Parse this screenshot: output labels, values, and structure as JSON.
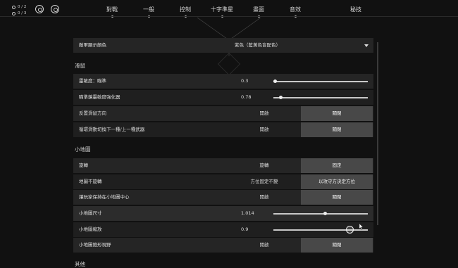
{
  "hud": {
    "counter_a": "0 / 2",
    "counter_b": "0 / 3"
  },
  "tabs": [
    {
      "label": "對戰"
    },
    {
      "label": "一般"
    },
    {
      "label": "控制"
    },
    {
      "label": "十字準星"
    },
    {
      "label": "畫面"
    },
    {
      "label": "音效"
    },
    {
      "label": "秘技"
    }
  ],
  "settings": {
    "highlight_color": {
      "label": "敵軍顯示顏色",
      "value": "紫色（藍黃色盲配色）"
    },
    "mouse_section": "滑鼠",
    "sensitivity": {
      "label": "靈敏度：瞄準",
      "value": "0.3",
      "level": 0.02
    },
    "scope_multiplier": {
      "label": "瞄準鏡靈敏度強化器",
      "value": "0.78",
      "level": 0.08
    },
    "invert_mouse": {
      "label": "反置滑鼠方向",
      "on": "開啟",
      "off": "關閉"
    },
    "scroll_weapon": {
      "label": "循環滑動切換下一種/上一種武器",
      "on": "開啟",
      "off": "關閉"
    },
    "minimap_section": "小地圖",
    "rotate": {
      "label": "旋轉",
      "on": "旋轉",
      "off": "固定"
    },
    "fixed_orientation": {
      "label": "地圖不旋轉",
      "on": "方位固定不變",
      "off": "以攻守方決定方位"
    },
    "keep_centered": {
      "label": "讓玩家保持在小地圖中心",
      "on": "開啟",
      "off": "關閉"
    },
    "minimap_size": {
      "label": "小地圖尺寸",
      "value": "1.014",
      "level": 0.55
    },
    "minimap_zoom": {
      "label": "小地圖縮放",
      "value": "0.9",
      "level": 0.81
    },
    "vision_cones": {
      "label": "小地圖錐形視野",
      "on": "開啟",
      "off": "關閉"
    },
    "other_section": "其他"
  }
}
